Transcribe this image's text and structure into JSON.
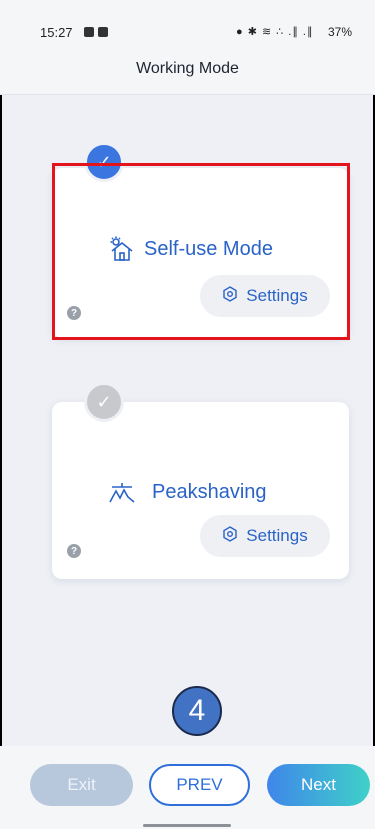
{
  "status_bar": {
    "time": "15:27",
    "icons_text": "● ✱ ≋ ∴ .∥ .∥",
    "battery": "37%"
  },
  "header": {
    "title": "Working Mode"
  },
  "modes": [
    {
      "label": "Self-use Mode",
      "settings_label": "Settings",
      "selected": true,
      "icon": "solar-house-icon"
    },
    {
      "label": "Peakshaving",
      "settings_label": "Settings",
      "selected": false,
      "icon": "peakshaving-icon"
    }
  ],
  "help_glyph": "?",
  "check_glyph": "✓",
  "step_marker": "4",
  "footer": {
    "exit_label": "Exit",
    "prev_label": "PREV",
    "next_label": "Next"
  },
  "colors": {
    "accent": "#2a63c8",
    "selected_check": "#3a75e0",
    "unselected_check": "#c7c9cd",
    "highlight": "#e3141b"
  }
}
